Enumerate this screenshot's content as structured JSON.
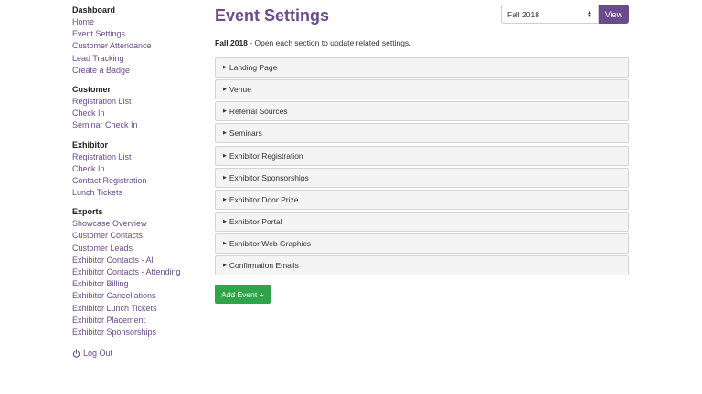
{
  "sidebar": {
    "groups": [
      {
        "heading": "Dashboard",
        "items": [
          "Home",
          "Event Settings",
          "Customer Attendance",
          "Lead Tracking",
          "Create a Badge"
        ]
      },
      {
        "heading": "Customer",
        "items": [
          "Registration List",
          "Check In",
          "Seminar Check In"
        ]
      },
      {
        "heading": "Exhibitor",
        "items": [
          "Registration List",
          "Check In",
          "Contact Registration",
          "Lunch Tickets"
        ]
      },
      {
        "heading": "Exports",
        "items": [
          "Showcase Overview",
          "Customer Contacts",
          "Customer Leads",
          "Exhibitor Contacts - All",
          "Exhibitor Contacts - Attending",
          "Exhibitor Billing",
          "Exhibitor Cancellations",
          "Exhibitor Lunch Tickets",
          "Exhibitor Placement",
          "Exhibitor Sponsorships"
        ]
      }
    ],
    "logout_label": "Log Out",
    "logout_icon": "power-icon"
  },
  "main": {
    "title": "Event Settings",
    "event_select_value": "Fall 2018",
    "view_button": "View",
    "subtitle_event": "Fall 2018",
    "subtitle_text": " - Open each section to update related settings.",
    "sections": [
      "Landing Page",
      "Venue",
      "Referral Sources",
      "Seminars",
      "Exhibitor Registration",
      "Exhibitor Sponsorships",
      "Exhibitor Door Prize",
      "Exhibitor Portal",
      "Exhibitor Web Graphics",
      "Confirmation Emails"
    ],
    "add_button": "Add Event +"
  },
  "colors": {
    "brand_purple": "#6b4b8b",
    "add_green": "#2ea548"
  }
}
